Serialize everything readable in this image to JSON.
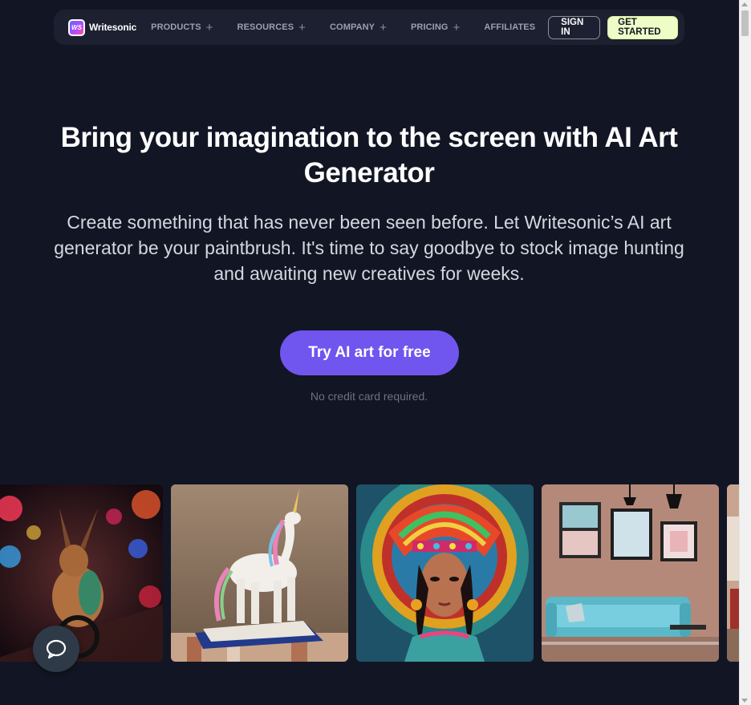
{
  "nav": {
    "brand": "Writesonic",
    "logo_mark": "WS",
    "items": [
      {
        "label": "PRODUCTS",
        "has_plus": true
      },
      {
        "label": "RESOURCES",
        "has_plus": true
      },
      {
        "label": "COMPANY",
        "has_plus": true
      },
      {
        "label": "PRICING",
        "has_plus": true
      },
      {
        "label": "AFFILIATES",
        "has_plus": false
      }
    ],
    "plus_glyph": "+",
    "sign_in": "SIGN IN",
    "get_started": "GET STARTED"
  },
  "hero": {
    "title": "Bring your imagination to the screen with AI Art Generator",
    "subtitle": "Create something that has never been seen before. Let Writesonic’s AI art generator be your paintbrush. It's time to say goodbye to stock image hunting and awaiting new creatives for weeks.",
    "cta": "Try AI art for free",
    "cta_note": "No credit card required."
  },
  "gallery": {
    "images": [
      "rabbit-on-bicycle-image",
      "unicorn-figurine-image",
      "aztec-woman-portrait-image",
      "living-room-interior-image",
      "partial-interior-image"
    ]
  },
  "icons": {
    "chat": "chat-bubble-icon"
  },
  "colors": {
    "background": "#121624",
    "navbar": "#1c2030",
    "cta": "#7055ee",
    "get_started": "#eefcc8",
    "chat": "#2e3a47"
  }
}
